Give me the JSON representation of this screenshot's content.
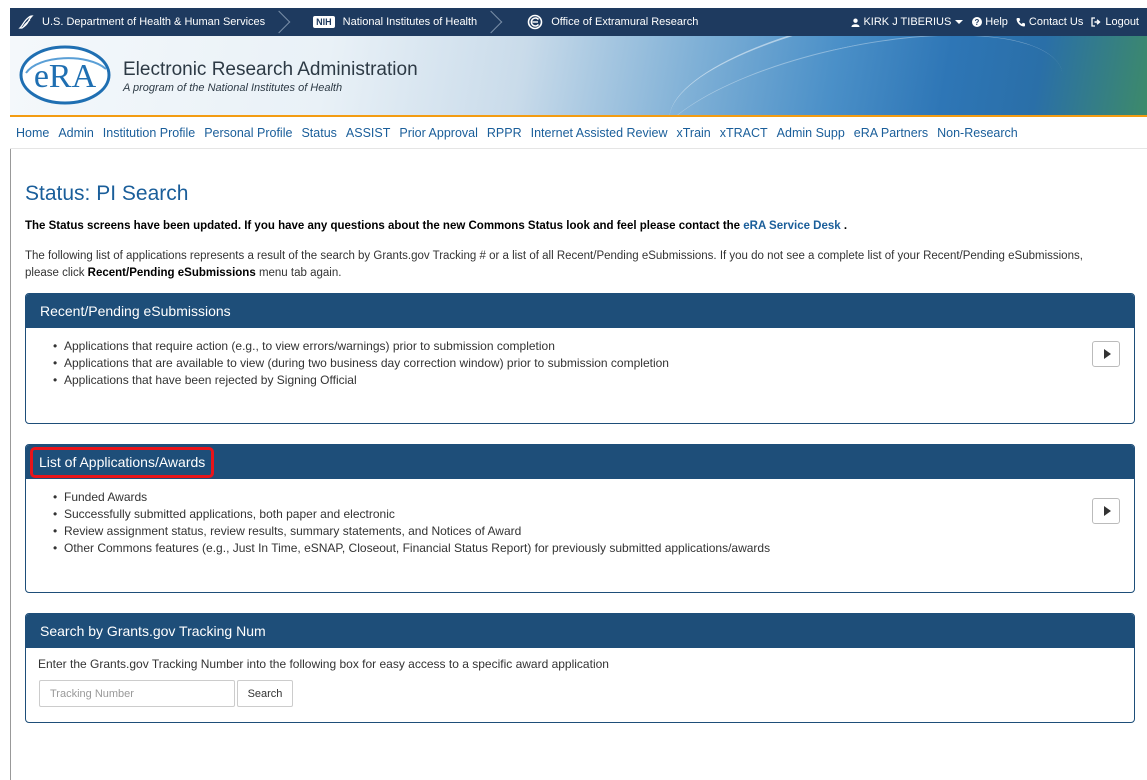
{
  "gov_bar": {
    "hhs_label": "U.S. Department of Health & Human Services",
    "nih_badge": "NIH",
    "nih_label": "National Institutes of Health",
    "oer_label": "Office of Extramural Research",
    "user_name": "KIRK J TIBERIUS",
    "help_label": "Help",
    "contact_label": "Contact Us",
    "logout_label": "Logout"
  },
  "banner": {
    "logo_text": "eRA",
    "title": "Electronic Research Administration",
    "subtitle": "A program of the National Institutes of Health"
  },
  "nav": {
    "items": [
      "Home",
      "Admin",
      "Institution Profile",
      "Personal Profile",
      "Status",
      "ASSIST",
      "Prior Approval",
      "RPPR",
      "Internet Assisted Review",
      "xTrain",
      "xTRACT",
      "Admin Supp",
      "eRA Partners",
      "Non-Research"
    ]
  },
  "page": {
    "title": "Status: PI Search",
    "notice_text": "The Status screens have been updated. If you have any questions about the new Commons Status look and feel please contact the",
    "notice_link": "eRA Service Desk",
    "notice_end": ".",
    "intro_1": "The following list of applications represents a result of the search by Grants.gov Tracking # or a list of all Recent/Pending eSubmissions. If you do not see a complete list of your Recent/Pending eSubmissions, please click",
    "intro_bold": "Recent/Pending eSubmissions",
    "intro_2": "menu tab again."
  },
  "panels": {
    "recent": {
      "title": "Recent/Pending eSubmissions",
      "bullets": [
        "Applications that require action (e.g., to view errors/warnings) prior to submission completion",
        "Applications that are available to view (during two business day correction window) prior to submission completion",
        "Applications that have been rejected by Signing Official"
      ]
    },
    "list": {
      "title": "List of Applications/Awards",
      "bullets": [
        "Funded Awards",
        "Successfully submitted applications, both paper and electronic",
        "Review assignment status, review results, summary statements, and Notices of Award",
        "Other Commons features (e.g., Just In Time, eSNAP, Closeout, Financial Status Report) for previously submitted applications/awards"
      ]
    },
    "search": {
      "title": "Search by Grants.gov Tracking Num",
      "description": "Enter the Grants.gov Tracking Number into the following box for easy access to a specific award application",
      "placeholder": "Tracking Number",
      "button_label": "Search"
    }
  },
  "colors": {
    "gov_bar": "#1e3a5f",
    "panel_header": "#1e4e79",
    "link": "#1a5e9a",
    "nav_accent": "#f39c12",
    "highlight": "#e8141a"
  }
}
